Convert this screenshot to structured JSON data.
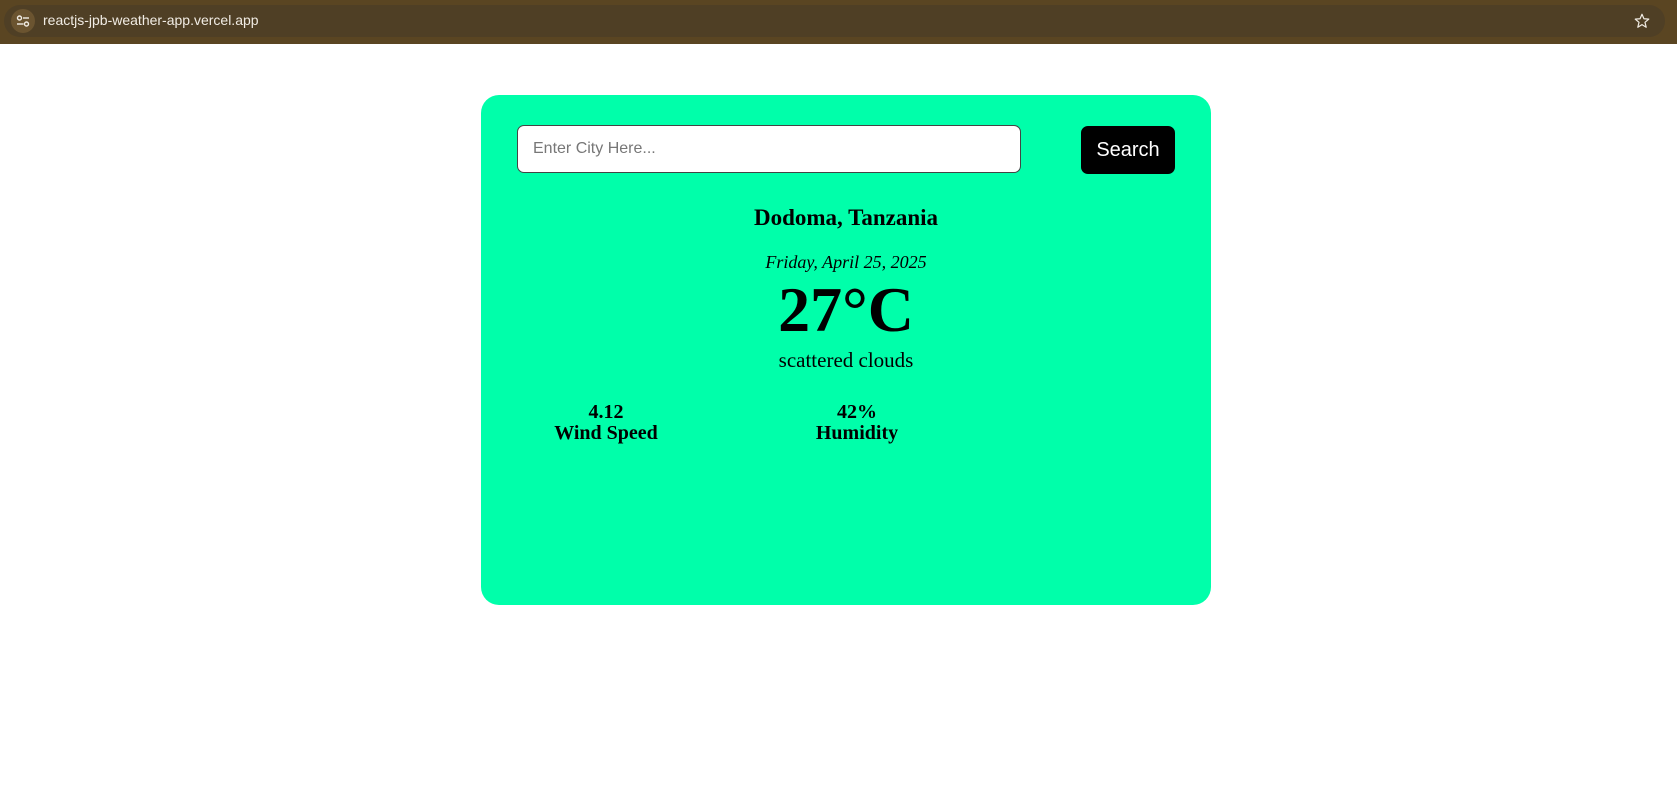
{
  "browser": {
    "url": "reactjs-jpb-weather-app.vercel.app"
  },
  "search": {
    "placeholder": "Enter City Here...",
    "value": "",
    "button_label": "Search"
  },
  "weather": {
    "location": "Dodoma, Tanzania",
    "date": "Friday, April 25, 2025",
    "temperature": "27°C",
    "description": "scattered clouds",
    "wind_speed": {
      "value": "4.12",
      "label": "Wind Speed"
    },
    "humidity": {
      "value": "42%",
      "label": "Humidity"
    }
  },
  "colors": {
    "card_background": "#00ffaa",
    "button_background": "#000000",
    "browser_bar": "#5a4522"
  }
}
